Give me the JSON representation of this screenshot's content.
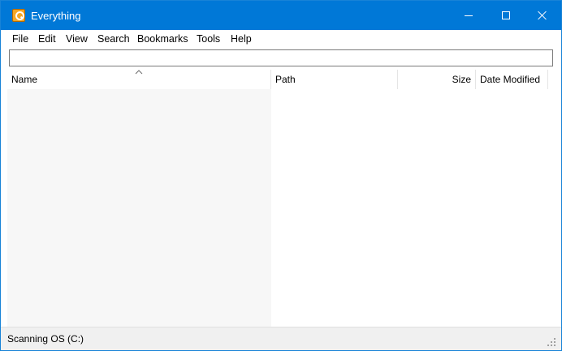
{
  "window": {
    "title": "Everything",
    "icon": "everything-app-icon",
    "title_bar_color": "#0078d7"
  },
  "menu": {
    "items": [
      "File",
      "Edit",
      "View",
      "Search",
      "Bookmarks",
      "Tools",
      "Help"
    ]
  },
  "search": {
    "value": "",
    "placeholder": ""
  },
  "list": {
    "columns": [
      "Name",
      "Path",
      "Size",
      "Date Modified"
    ],
    "sort_column": "Name",
    "sort_direction": "ascending",
    "rows": []
  },
  "status": {
    "text": "Scanning OS (C:)"
  }
}
